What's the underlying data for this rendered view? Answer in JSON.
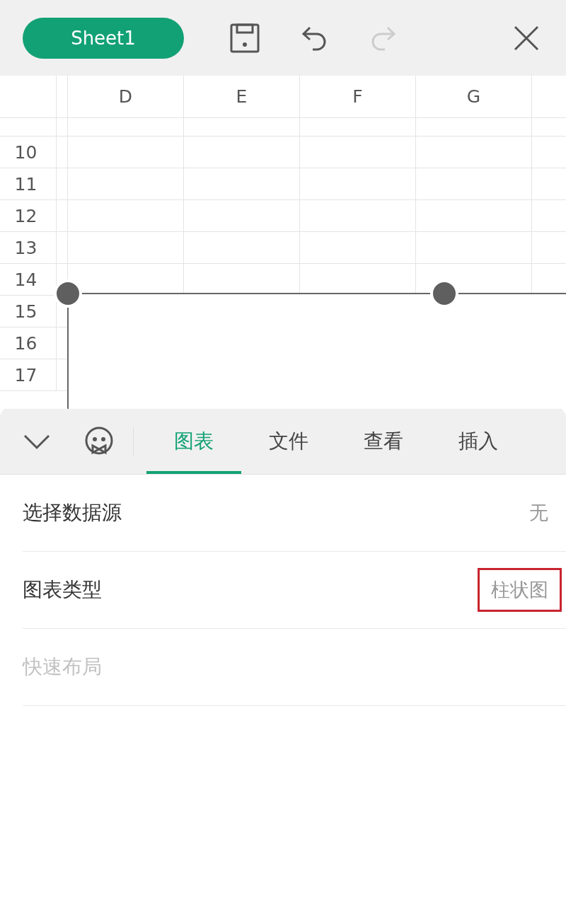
{
  "top_bar": {
    "sheet_name": "Sheet1",
    "redo_disabled": true
  },
  "sheet": {
    "columns": [
      "D",
      "E",
      "F",
      "G"
    ],
    "rows": [
      "10",
      "11",
      "12",
      "13",
      "14",
      "15",
      "16",
      "17"
    ]
  },
  "panel": {
    "tabs": [
      {
        "label": "图表",
        "selected": true
      },
      {
        "label": "文件",
        "selected": false
      },
      {
        "label": "查看",
        "selected": false
      },
      {
        "label": "插入",
        "selected": false
      }
    ],
    "options": [
      {
        "label": "选择数据源",
        "value": "无",
        "disabled": false,
        "highlighted": false
      },
      {
        "label": "图表类型",
        "value": "柱状图",
        "disabled": false,
        "highlighted": true
      },
      {
        "label": "快速布局",
        "disabled": true
      }
    ]
  }
}
